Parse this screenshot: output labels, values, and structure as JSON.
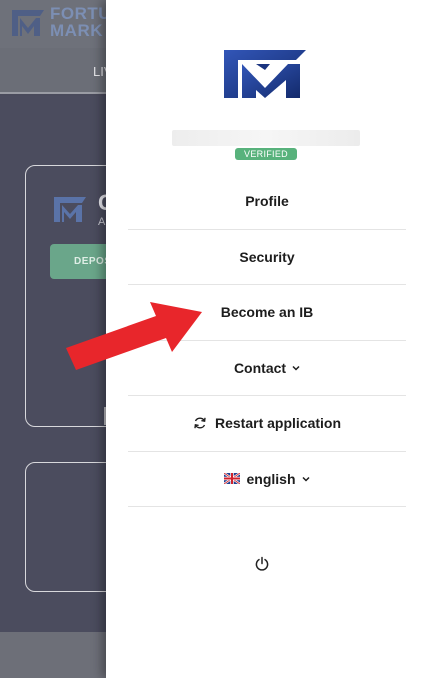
{
  "background": {
    "brand_line1": "FORTU",
    "brand_line2": "MARK",
    "nav_text": "LIV",
    "card_title": "C",
    "card_subtitle": "A",
    "deposit_label": "DEPOS"
  },
  "drawer": {
    "badge": "VERIFIED",
    "menu": {
      "profile": "Profile",
      "security": "Security",
      "become_ib": "Become an IB",
      "contact": "Contact",
      "restart": "Restart application",
      "language": "english"
    }
  },
  "icons": {
    "logo": "fm-logo-icon",
    "chevron": "chevron-down-icon",
    "restart": "refresh-icon",
    "flag": "uk-flag-icon",
    "power": "power-icon",
    "annotation": "red-arrow-icon"
  },
  "colors": {
    "verified_badge": "#58b27c",
    "deposit_button": "#6aa68a",
    "annotation_arrow": "#e8262b",
    "logo_blue": "#1f3f8f"
  }
}
